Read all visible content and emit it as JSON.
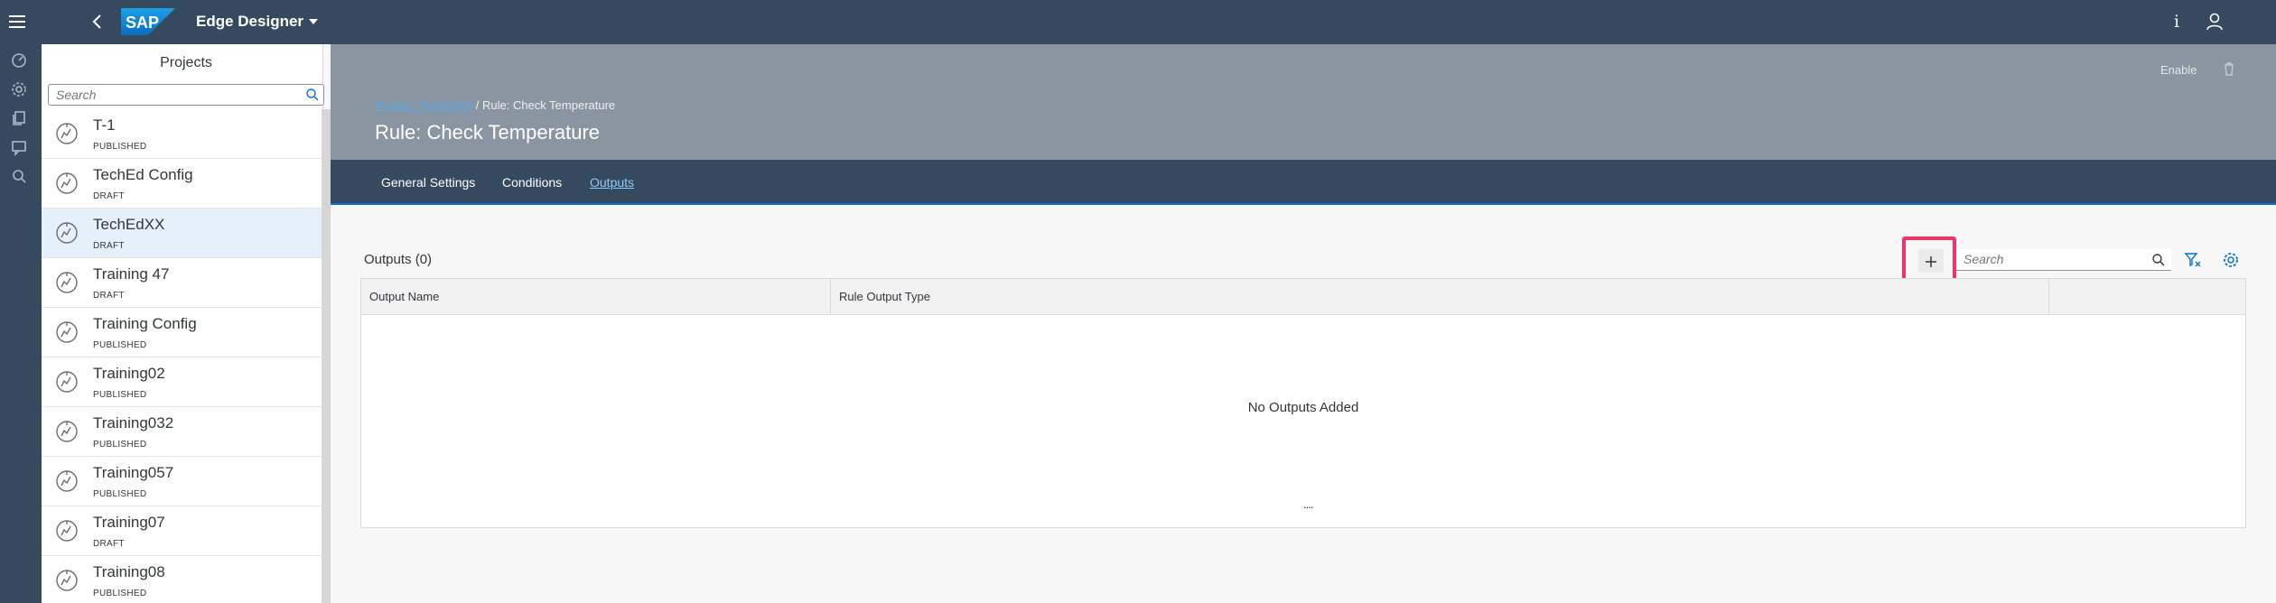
{
  "shell": {
    "app_title": "Edge Designer",
    "logo_text": "SAP",
    "info_label": "i"
  },
  "projects": {
    "title": "Projects",
    "search_placeholder": "Search",
    "items": [
      {
        "name": "T-1",
        "status": "PUBLISHED",
        "selected": false
      },
      {
        "name": "TechEd Config",
        "status": "DRAFT",
        "selected": false
      },
      {
        "name": "TechEdXX",
        "status": "DRAFT",
        "selected": true
      },
      {
        "name": "Training 47",
        "status": "DRAFT",
        "selected": false
      },
      {
        "name": "Training Config",
        "status": "PUBLISHED",
        "selected": false
      },
      {
        "name": "Training02",
        "status": "PUBLISHED",
        "selected": false
      },
      {
        "name": "Training032",
        "status": "PUBLISHED",
        "selected": false
      },
      {
        "name": "Training057",
        "status": "PUBLISHED",
        "selected": false
      },
      {
        "name": "Training07",
        "status": "DRAFT",
        "selected": false
      },
      {
        "name": "Training08",
        "status": "PUBLISHED",
        "selected": false
      }
    ]
  },
  "header": {
    "enable_label": "Enable",
    "breadcrumb_link": "Project: TechEdXX",
    "breadcrumb_current": " / Rule: Check Temperature",
    "page_title": "Rule: Check Temperature"
  },
  "tabs": [
    {
      "label": "General Settings",
      "active": false
    },
    {
      "label": "Conditions",
      "active": false
    },
    {
      "label": "Outputs",
      "active": true
    }
  ],
  "outputs": {
    "title": "Outputs (0)",
    "search_placeholder": "Search",
    "columns": [
      "Output Name",
      "Rule Output Type",
      ""
    ],
    "empty_text": "No Outputs Added",
    "grabber": "....",
    "highlight_color": "#f0336b"
  },
  "colors": {
    "shell": "#354a5f",
    "header": "#8996a1",
    "accent": "#0a6ed1"
  }
}
